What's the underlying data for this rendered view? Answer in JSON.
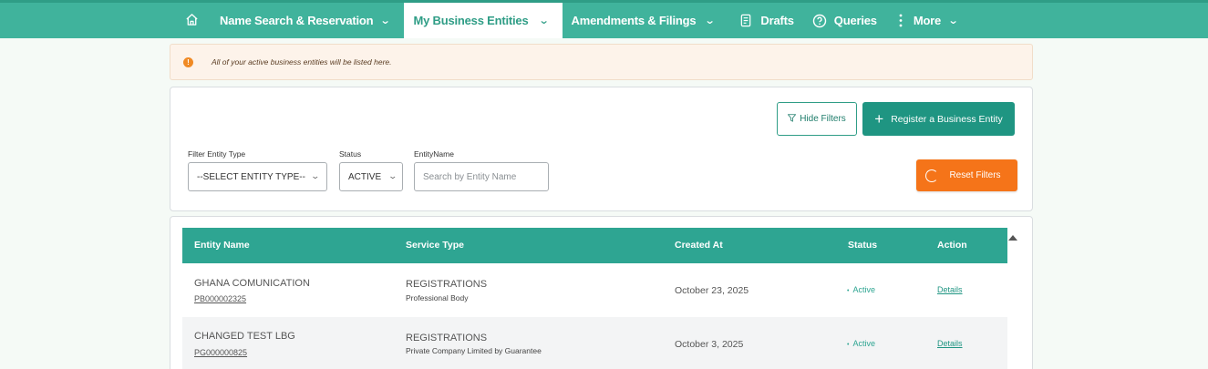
{
  "nav": {
    "home_icon": "home-icon",
    "items": [
      {
        "label": "Name Search & Reservation",
        "dropdown": true
      },
      {
        "label": "My Business Entities",
        "dropdown": true,
        "active": true
      },
      {
        "label": "Amendments & Filings",
        "dropdown": true
      },
      {
        "label": "Drafts",
        "icon": "drafts-icon"
      },
      {
        "label": "Queries",
        "icon": "help-circle-icon"
      },
      {
        "label": "More",
        "icon": "more-vertical-icon",
        "dropdown": true
      }
    ]
  },
  "banner": {
    "text": "All of your active business entities will be listed here.",
    "icon": "alert-icon"
  },
  "filters": {
    "hide_filters_label": "Hide Filters",
    "register_label": "Register a Business Entity",
    "reset_label": "Reset Filters",
    "entity_type_label": "Filter Entity Type",
    "entity_type_value": "--SELECT ENTITY TYPE--",
    "status_label": "Status",
    "status_value": "ACTIVE",
    "entity_name_label": "EntityName",
    "entity_name_placeholder": "Search by Entity Name"
  },
  "table": {
    "headers": {
      "entity_name": "Entity Name",
      "service_type": "Service Type",
      "created_at": "Created At",
      "status": "Status",
      "action": "Action"
    },
    "rows": [
      {
        "entity_name": "GHANA COMUNICATION",
        "code": "PB000002325",
        "service": "REGISTRATIONS",
        "service_sub": "Professional Body",
        "created": "October 23, 2025",
        "status": "Active",
        "action": "Details"
      },
      {
        "entity_name": "CHANGED TEST LBG",
        "code": "PG000000825",
        "service": "REGISTRATIONS",
        "service_sub": "Private Company Limited by Guarantee",
        "created": "October 3, 2025",
        "status": "Active",
        "action": "Details"
      }
    ]
  },
  "colors": {
    "nav": "#40b39c",
    "primary": "#1f9582",
    "accent_orange": "#f57419",
    "banner_bg": "#fdf3ea"
  }
}
